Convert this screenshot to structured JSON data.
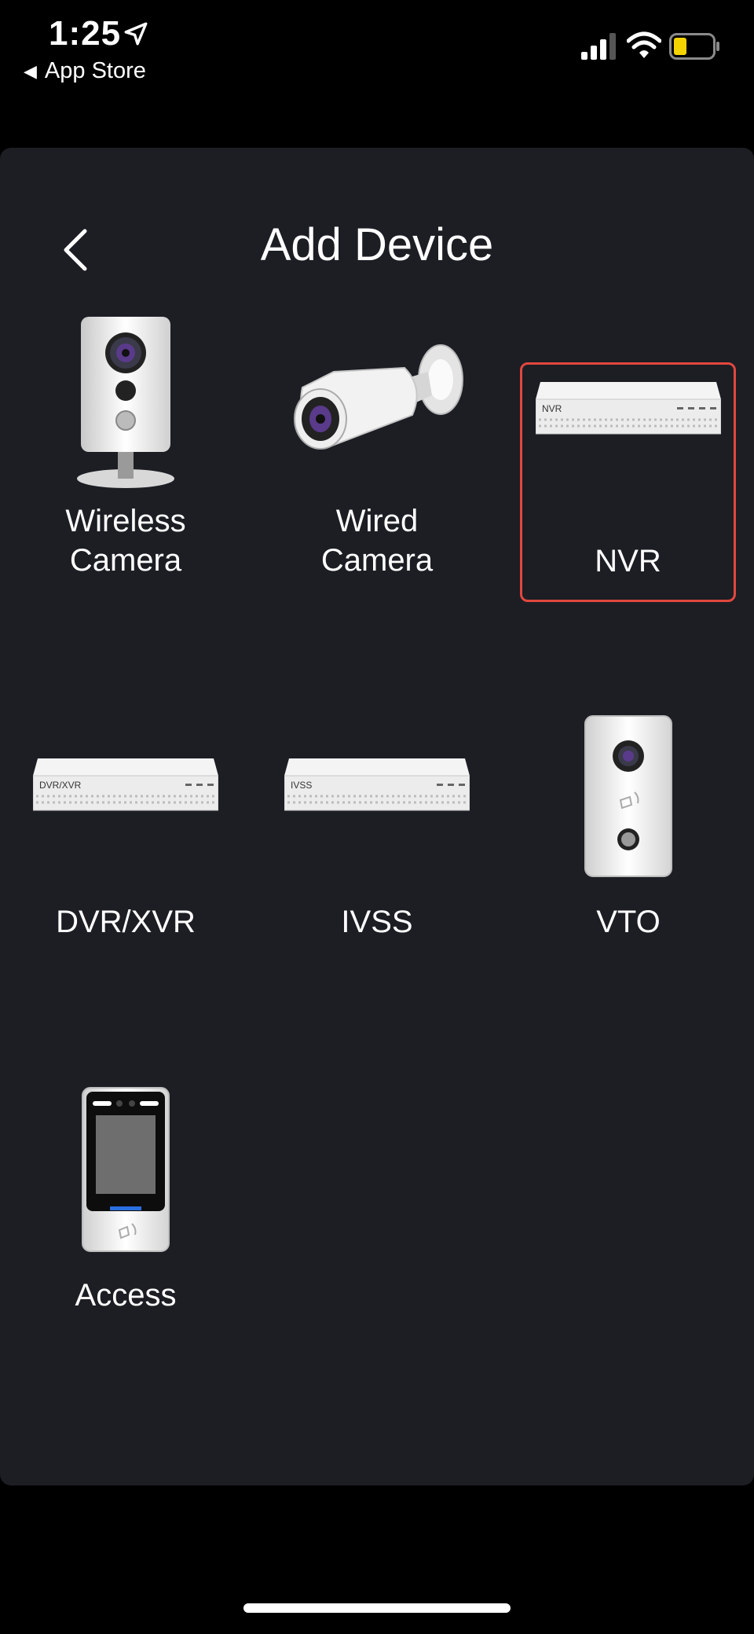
{
  "status": {
    "time": "1:25",
    "back_app": "App Store",
    "icons": [
      "location-arrow-icon",
      "signal-icon",
      "wifi-icon",
      "battery-icon"
    ],
    "battery_color": "#f5d300"
  },
  "header": {
    "title": "Add Device",
    "back_icon": "chevron-left-icon"
  },
  "devices": [
    {
      "label": "Wireless\nCamera",
      "icon": "wireless-camera-icon",
      "selected": false
    },
    {
      "label": "Wired\nCamera",
      "icon": "wired-camera-icon",
      "selected": false
    },
    {
      "label": "NVR",
      "icon": "nvr-recorder-icon",
      "selected": true,
      "device_text": "NVR"
    },
    {
      "label": "DVR/XVR",
      "icon": "dvr-recorder-icon",
      "selected": false,
      "device_text": "DVR/XVR"
    },
    {
      "label": "IVSS",
      "icon": "ivss-recorder-icon",
      "selected": false,
      "device_text": "IVSS"
    },
    {
      "label": "VTO",
      "icon": "vto-doorbell-icon",
      "selected": false
    },
    {
      "label": "Access",
      "icon": "access-terminal-icon",
      "selected": false
    }
  ],
  "colors": {
    "background": "#000000",
    "panel": "#1c1e24",
    "selection_border": "#e2473f"
  }
}
